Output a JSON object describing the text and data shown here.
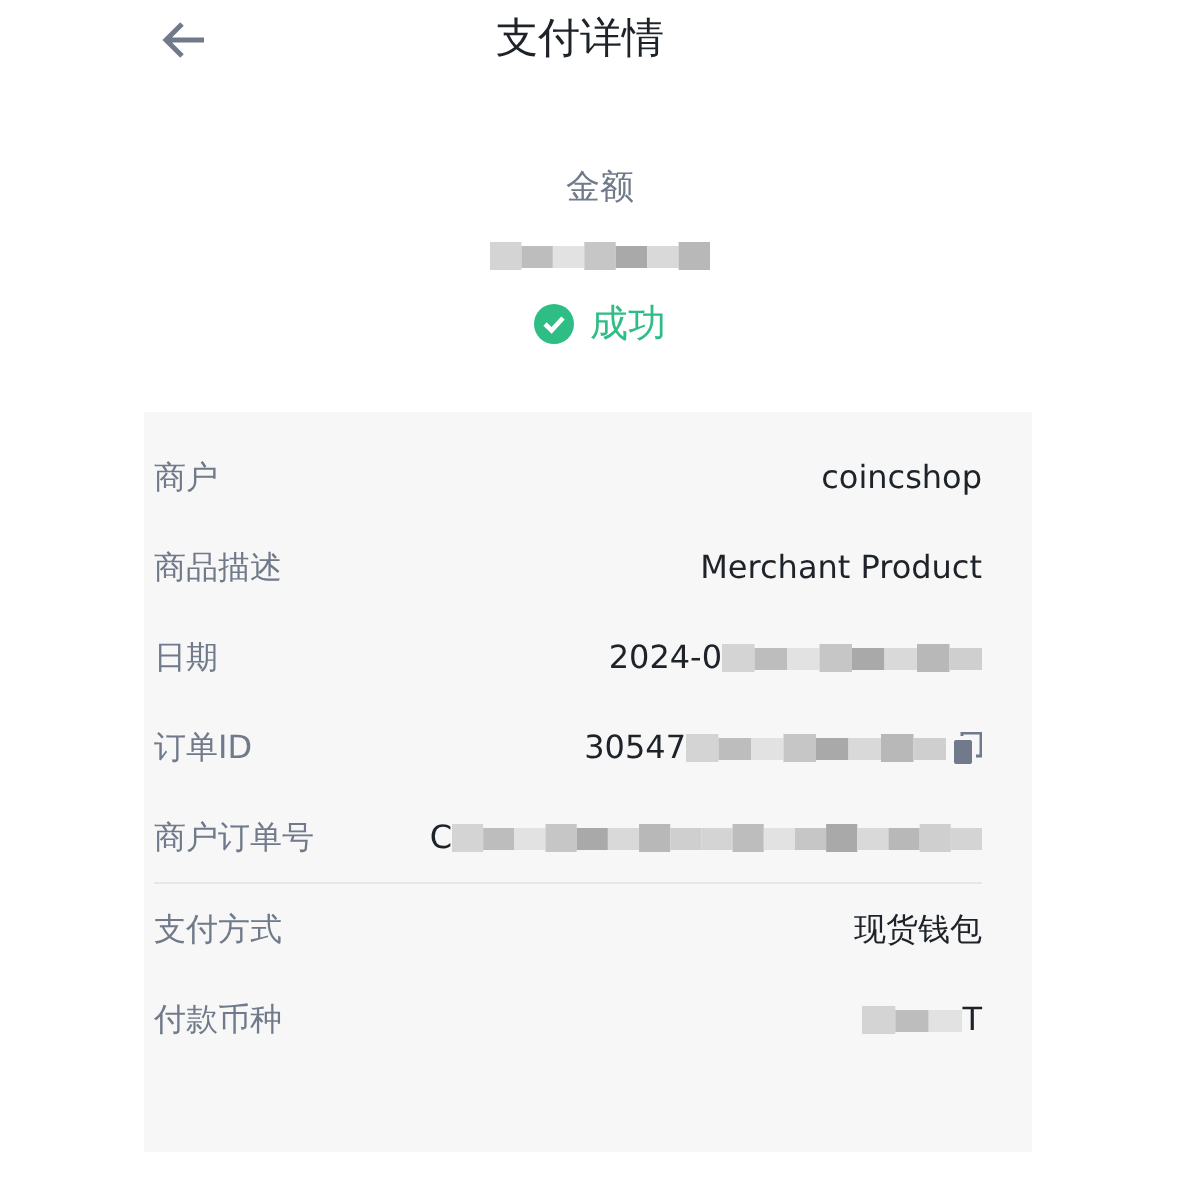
{
  "header": {
    "title": "支付详情"
  },
  "summary": {
    "label": "金额",
    "amount_redacted": true,
    "status": "成功"
  },
  "sections": [
    {
      "rows": [
        {
          "label": "商户",
          "value": "coincshop",
          "redacted": false,
          "copyable": false
        },
        {
          "label": "商品描述",
          "value": "Merchant Product",
          "redacted": false,
          "copyable": false
        },
        {
          "label": "日期",
          "value": "2024-0",
          "redacted": true,
          "copyable": false
        },
        {
          "label": "订单ID",
          "value": "30547",
          "redacted": true,
          "copyable": true
        },
        {
          "label": "商户订单号",
          "value": "C",
          "redacted": true,
          "copyable": false
        }
      ]
    },
    {
      "rows": [
        {
          "label": "支付方式",
          "value": "现货钱包",
          "redacted": false,
          "copyable": false
        },
        {
          "label": "付款币种",
          "value": "T",
          "redacted": true,
          "copyable": false,
          "redaction_first": true
        }
      ]
    }
  ]
}
